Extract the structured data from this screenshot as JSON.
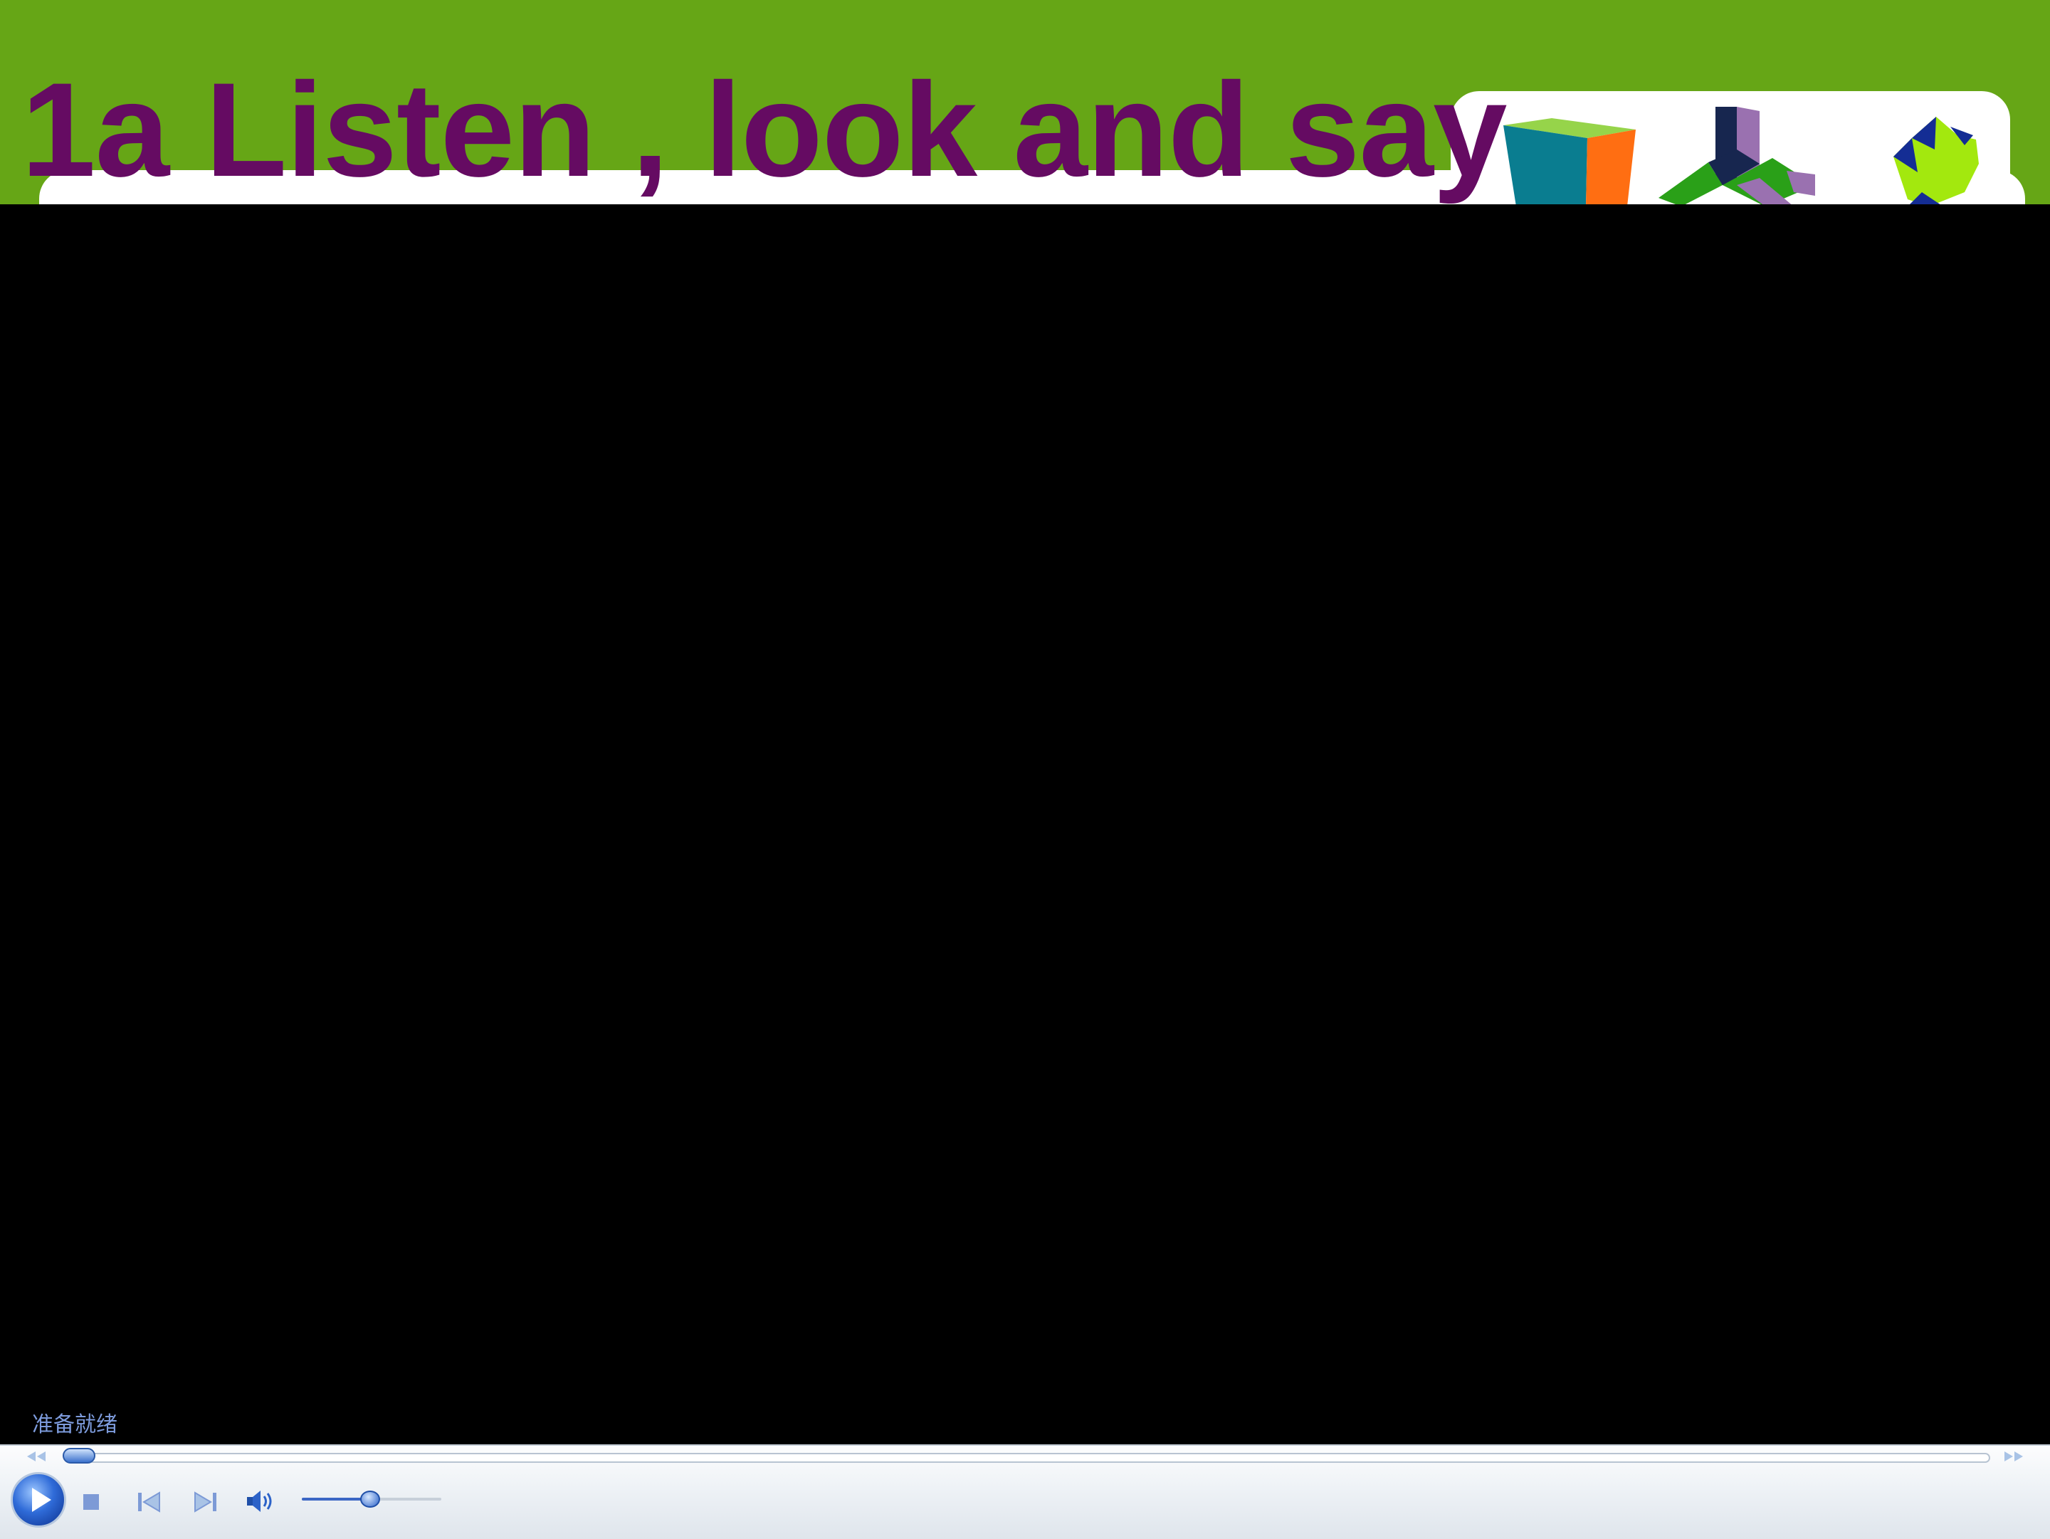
{
  "slide": {
    "title": "1a Listen , look and say",
    "colors": {
      "header_green": "#66a616",
      "title_purple": "#650b62"
    }
  },
  "player": {
    "status_text": "准备就绪",
    "seek_progress": 0.0,
    "volume_level": 0.5,
    "icons": {
      "rewind": "rewind-icon",
      "fast_forward": "fast-forward-icon",
      "play": "play-icon",
      "stop": "stop-icon",
      "previous": "previous-icon",
      "next": "next-icon",
      "mute": "speaker-icon"
    }
  }
}
